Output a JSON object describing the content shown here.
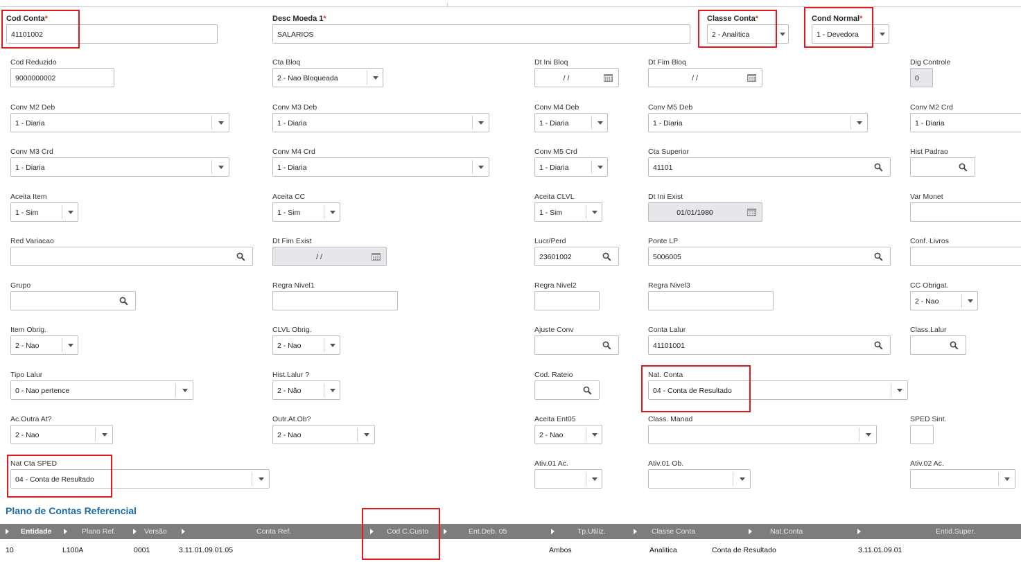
{
  "form": {
    "cod_conta": {
      "label": "Cod Conta",
      "required_mark": "*",
      "value": "41101002"
    },
    "desc_moeda": {
      "label": "Desc Moeda 1",
      "required_mark": "*",
      "value": "SALARIOS"
    },
    "classe_conta": {
      "label": "Classe Conta",
      "required_mark": "*",
      "value": "2 - Analitica"
    },
    "cond_normal": {
      "label": "Cond Normal",
      "required_mark": "*",
      "value": "1 - Devedora"
    },
    "cod_reduzido": {
      "label": "Cod Reduzido",
      "value": "9000000002"
    },
    "cta_bloq": {
      "label": "Cta Bloq",
      "value": "2 - Nao Bloqueada"
    },
    "dt_ini_bloq": {
      "label": "Dt Ini Bloq",
      "value": "/ /"
    },
    "dt_fim_bloq": {
      "label": "Dt Fim Bloq",
      "value": "/ /"
    },
    "dig_controle": {
      "label": "Dig Controle",
      "value": "0"
    },
    "conv_m2_deb": {
      "label": "Conv M2 Deb",
      "value": "1 - Diaria"
    },
    "conv_m3_deb": {
      "label": "Conv M3 Deb",
      "value": "1 - Diaria"
    },
    "conv_m4_deb": {
      "label": "Conv M4 Deb",
      "value": "1 - Diaria"
    },
    "conv_m5_deb": {
      "label": "Conv M5 Deb",
      "value": "1 - Diaria"
    },
    "conv_m2_crd": {
      "label": "Conv M2 Crd",
      "value": "1 - Diaria"
    },
    "conv_m3_crd": {
      "label": "Conv M3 Crd",
      "value": "1 - Diaria"
    },
    "conv_m4_crd": {
      "label": "Conv M4 Crd",
      "value": "1 - Diaria"
    },
    "conv_m5_crd": {
      "label": "Conv M5 Crd",
      "value": "1 - Diaria"
    },
    "cta_superior": {
      "label": "Cta Superior",
      "value": "41101"
    },
    "hist_padrao": {
      "label": "Hist Padrao",
      "value": ""
    },
    "aceita_item": {
      "label": "Aceita Item",
      "value": "1 - Sim"
    },
    "aceita_cc": {
      "label": "Aceita CC",
      "value": "1 - Sim"
    },
    "aceita_clvl": {
      "label": "Aceita CLVL",
      "value": "1 - Sim"
    },
    "dt_ini_exist": {
      "label": "Dt Ini Exist",
      "value": "01/01/1980"
    },
    "var_monet": {
      "label": "Var Monet",
      "value": ""
    },
    "red_variacao": {
      "label": "Red Variacao",
      "value": ""
    },
    "dt_fim_exist": {
      "label": "Dt Fim Exist",
      "value": "/ /"
    },
    "lucr_perd": {
      "label": "Lucr/Perd",
      "value": "23601002"
    },
    "ponte_lp": {
      "label": "Ponte LP",
      "value": "5006005"
    },
    "conf_livros": {
      "label": "Conf. Livros",
      "value": ""
    },
    "grupo": {
      "label": "Grupo",
      "value": ""
    },
    "regra_nivel1": {
      "label": "Regra Nivel1",
      "value": ""
    },
    "regra_nivel2": {
      "label": "Regra Nivel2",
      "value": ""
    },
    "regra_nivel3": {
      "label": "Regra Nivel3",
      "value": ""
    },
    "cc_obrigat": {
      "label": "CC Obrigat.",
      "value": "2 - Nao"
    },
    "item_obrig": {
      "label": "Item Obrig.",
      "value": "2 - Nao"
    },
    "clvl_obrig": {
      "label": "CLVL Obrig.",
      "value": "2 - Nao"
    },
    "ajuste_conv": {
      "label": "Ajuste Conv",
      "value": ""
    },
    "conta_lalur": {
      "label": "Conta Lalur",
      "value": "41101001"
    },
    "class_lalur": {
      "label": "Class.Lalur",
      "value": ""
    },
    "tipo_lalur": {
      "label": "Tipo Lalur",
      "value": "0 - Nao pertence"
    },
    "hist_lalur": {
      "label": "Hist.Lalur ?",
      "value": "2 - Não"
    },
    "cod_rateio": {
      "label": "Cod. Rateio",
      "value": ""
    },
    "nat_conta": {
      "label": "Nat. Conta",
      "value": "04 - Conta de Resultado"
    },
    "ac_outra_at": {
      "label": "Ac.Outra At?",
      "value": "2 - Nao"
    },
    "outr_at_ob": {
      "label": "Outr.At.Ob?",
      "value": "2 - Nao"
    },
    "aceita_ent05": {
      "label": "Aceita Ent05",
      "value": "2 - Nao"
    },
    "class_manad": {
      "label": "Class. Manad",
      "value": ""
    },
    "sped_sint": {
      "label": "SPED Sint.",
      "value": ""
    },
    "nat_cta_sped": {
      "label": "Nat Cta SPED",
      "value": "04 - Conta de Resultado"
    },
    "ativ01_ac": {
      "label": "Ativ.01 Ac.",
      "value": ""
    },
    "ativ01_ob": {
      "label": "Ativ.01 Ob.",
      "value": ""
    },
    "ativ02_ac": {
      "label": "Ativ.02 Ac.",
      "value": ""
    }
  },
  "grid": {
    "title": "Plano de Contas Referencial",
    "headers": [
      "Entidade",
      "Plano Ref.",
      "Versão",
      "Conta Ref.",
      "Cod C.Custo",
      "Ent.Deb. 05",
      "Tp.Utiliz.",
      "Classe Conta",
      "Nat.Conta",
      "Entid.Super."
    ],
    "rows": [
      [
        "10",
        "L100A",
        "0001",
        "3.11.01.09.01.05",
        "",
        "",
        "Ambos",
        "Analitica",
        "Conta de Resultado",
        "3.11.01.09.01"
      ]
    ]
  },
  "colors": {
    "highlight": "#e0191f",
    "section_title": "#1a6aa8",
    "grid_header": "#7d7d7d"
  }
}
